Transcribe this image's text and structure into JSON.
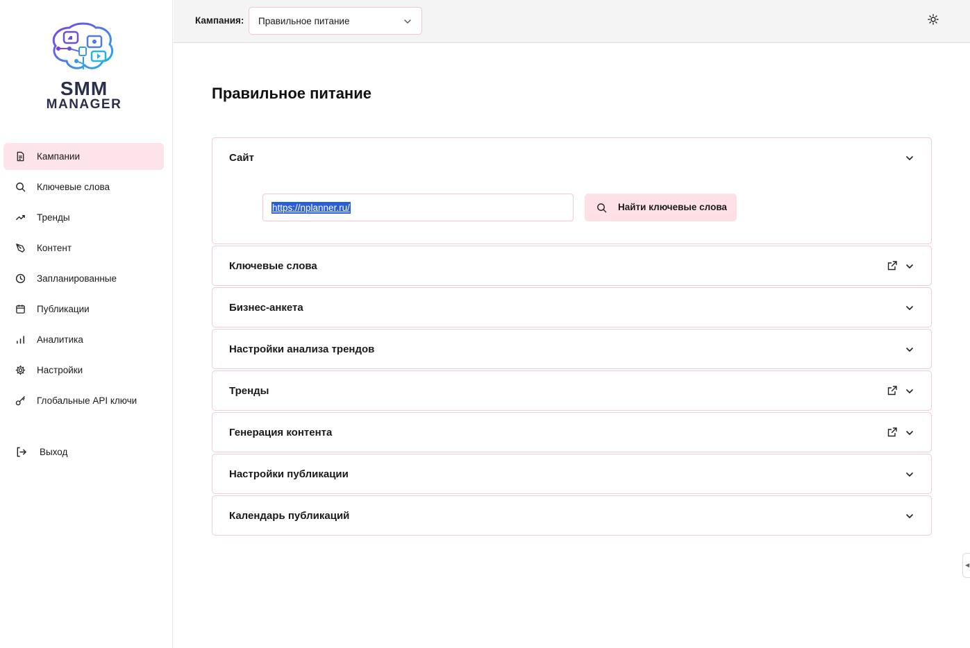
{
  "app": {
    "logo_line1": "SMM",
    "logo_line2": "MANAGER",
    "logo_icon": "brain-social-icon"
  },
  "sidebar": {
    "items": [
      {
        "label": "Кампании",
        "icon": "document-icon",
        "active": true
      },
      {
        "label": "Ключевые слова",
        "icon": "search-icon",
        "active": false
      },
      {
        "label": "Тренды",
        "icon": "trending-up-icon",
        "active": false
      },
      {
        "label": "Контент",
        "icon": "pen-icon",
        "active": false
      },
      {
        "label": "Запланированные",
        "icon": "clock-icon",
        "active": false
      },
      {
        "label": "Публикации",
        "icon": "calendar-icon",
        "active": false
      },
      {
        "label": "Аналитика",
        "icon": "bar-chart-icon",
        "active": false
      },
      {
        "label": "Настройки",
        "icon": "gear-icon",
        "active": false
      },
      {
        "label": "Глобальные API ключи",
        "icon": "key-icon",
        "active": false
      }
    ],
    "logout_label": "Выход"
  },
  "topbar": {
    "campaign_label": "Кампания:",
    "campaign_value": "Правильное питание",
    "theme_icon": "sun-icon"
  },
  "main": {
    "title": "Правильное питание",
    "site_panel": {
      "title": "Сайт",
      "url_value": "https://nplanner.ru/",
      "find_button": "Найти ключевые слова"
    },
    "panels": [
      {
        "title": "Ключевые слова",
        "external": true
      },
      {
        "title": "Бизнес-анкета",
        "external": false
      },
      {
        "title": "Настройки анализа трендов",
        "external": false
      },
      {
        "title": "Тренды",
        "external": true
      },
      {
        "title": "Генерация контента",
        "external": true
      },
      {
        "title": "Настройки публикации",
        "external": false
      },
      {
        "title": "Календарь публикаций",
        "external": false
      }
    ]
  },
  "colors": {
    "accent_bg": "#fde4ea",
    "accent_border": "#f3cbd4",
    "selection": "#2a5ed6"
  }
}
